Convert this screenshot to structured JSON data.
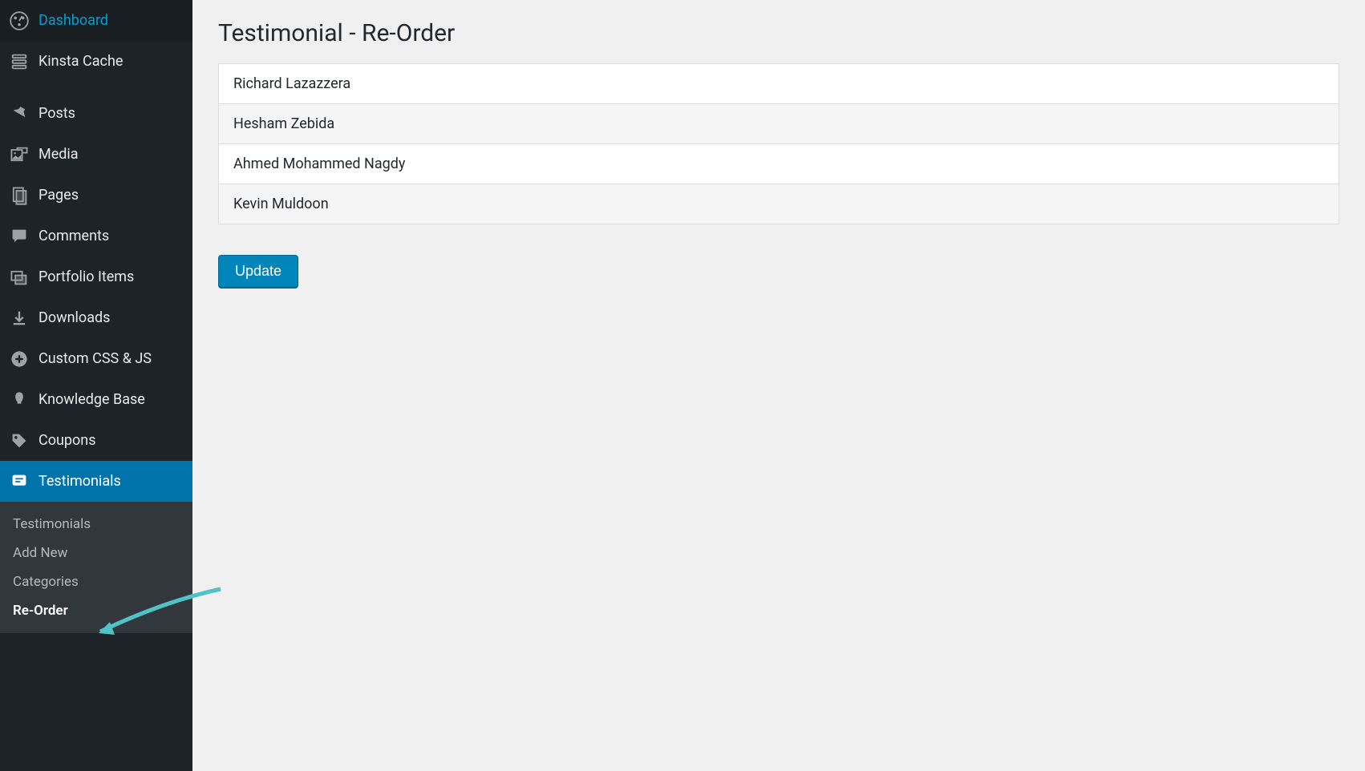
{
  "sidebar": {
    "items": [
      {
        "icon": "dashboard",
        "label": "Dashboard"
      },
      {
        "icon": "cache",
        "label": "Kinsta Cache"
      },
      {
        "icon": "pin",
        "label": "Posts"
      },
      {
        "icon": "media",
        "label": "Media"
      },
      {
        "icon": "pages",
        "label": "Pages"
      },
      {
        "icon": "comments",
        "label": "Comments"
      },
      {
        "icon": "portfolio",
        "label": "Portfolio Items"
      },
      {
        "icon": "downloads",
        "label": "Downloads"
      },
      {
        "icon": "css",
        "label": "Custom CSS & JS"
      },
      {
        "icon": "bulb",
        "label": "Knowledge Base"
      },
      {
        "icon": "tag",
        "label": "Coupons"
      },
      {
        "icon": "testimonials",
        "label": "Testimonials"
      }
    ],
    "submenu": [
      {
        "label": "Testimonials"
      },
      {
        "label": "Add New"
      },
      {
        "label": "Categories"
      },
      {
        "label": "Re-Order"
      }
    ]
  },
  "main": {
    "title": "Testimonial - Re-Order",
    "items": [
      {
        "name": "Richard Lazazzera"
      },
      {
        "name": "Hesham Zebida"
      },
      {
        "name": "Ahmed Mohammed Nagdy"
      },
      {
        "name": "Kevin Muldoon"
      }
    ],
    "button_label": "Update"
  }
}
